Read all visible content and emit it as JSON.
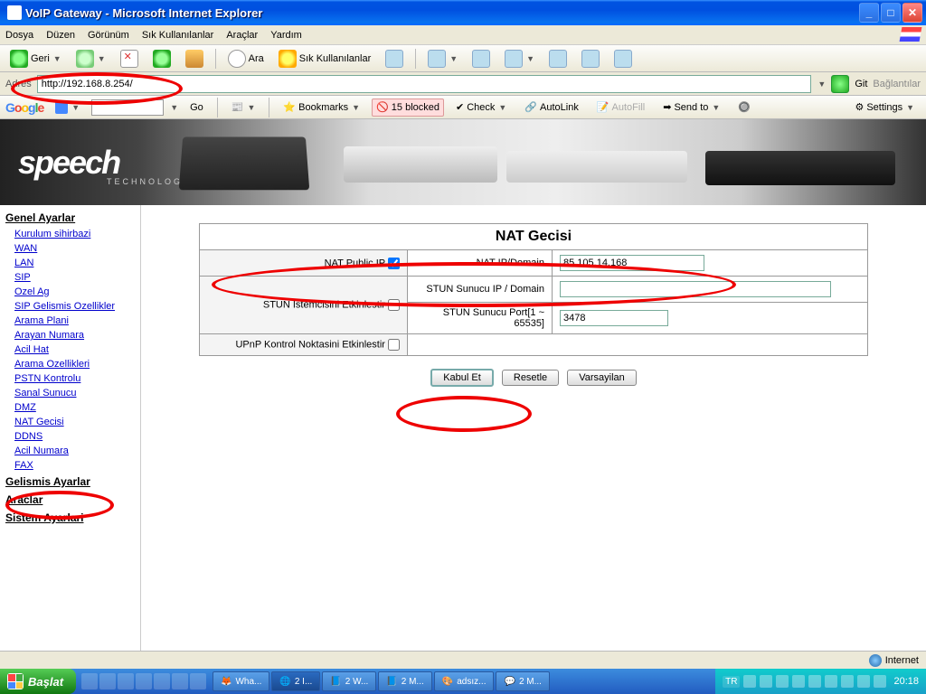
{
  "window": {
    "title": "VoIP Gateway - Microsoft Internet Explorer"
  },
  "menu": {
    "file": "Dosya",
    "edit": "Düzen",
    "view": "Görünüm",
    "fav": "Sık Kullanılanlar",
    "tools": "Araçlar",
    "help": "Yardım"
  },
  "toolbar": {
    "back": "Geri",
    "search": "Ara",
    "favorites": "Sık Kullanılanlar"
  },
  "address": {
    "label": "Adres",
    "url": "http://192.168.8.254/",
    "go": "Git",
    "links": "Bağlantılar"
  },
  "google": {
    "go": "Go",
    "bookmarks": "Bookmarks",
    "blocked": "15 blocked",
    "check": "Check",
    "autolink": "AutoLink",
    "autofill": "AutoFill",
    "sendto": "Send to",
    "settings": "Settings"
  },
  "banner": {
    "logo": "speech",
    "sub": "TECHNOLOGIES"
  },
  "sidebar": {
    "cat1": "Genel Ayarlar",
    "items": [
      "Kurulum sihirbazi",
      "WAN",
      "LAN",
      "SIP",
      "Ozel Ag",
      "SIP Gelismis Ozellikler",
      "Arama Plani",
      "Arayan Numara",
      "Acil Hat",
      "Arama Ozellikleri",
      "PSTN Kontrolu",
      "Sanal Sunucu",
      "DMZ",
      "NAT Gecisi",
      "DDNS",
      "Acil Numara",
      "FAX"
    ],
    "cat2": "Gelismis Ayarlar",
    "cat3": "Araclar",
    "cat4": "Sistem Ayarlari"
  },
  "form": {
    "title": "NAT Gecisi",
    "nat_public_ip": "NAT Public IP",
    "nat_ip_domain": "NAT IP/Domain",
    "nat_ip_value": "85.105.14.168",
    "stun_enable": "STUN Istemcisini Etkinlestir",
    "stun_server": "STUN Sunucu IP / Domain",
    "stun_server_value": "",
    "stun_port": "STUN Sunucu Port[1 ~ 65535]",
    "stun_port_value": "3478",
    "upnp": "UPnP Kontrol Noktasini Etkinlestir",
    "btn_accept": "Kabul Et",
    "btn_reset": "Resetle",
    "btn_default": "Varsayilan"
  },
  "status": {
    "zone": "Internet"
  },
  "taskbar": {
    "start": "Başlat",
    "tasks": [
      "Wha...",
      "2 I...",
      "2 W...",
      "2 M...",
      "adsız...",
      "2 M..."
    ],
    "lang": "TR",
    "clock": "20:18"
  }
}
